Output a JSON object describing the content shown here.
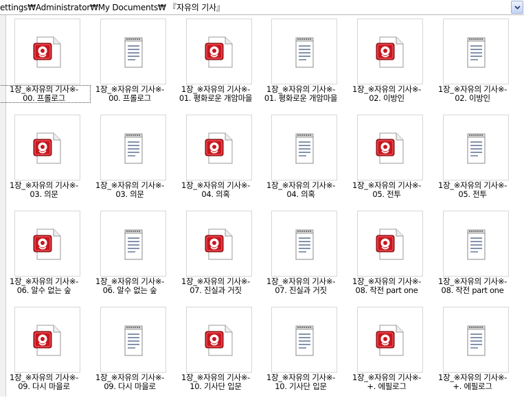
{
  "address": {
    "path": "ettings₩Administrator₩My Documents₩ 『자유의 기사』"
  },
  "colors": {
    "media_icon_red": "#c8161e",
    "doc_icon_blue": "#5a6e8f",
    "thumb_border": "#d6d6d6"
  },
  "files": [
    {
      "line1": "1장_※자유의 기사※-",
      "line2": "00. 프롤로그",
      "icon": "media-file-icon"
    },
    {
      "line1": "1장_※자유의 기사※-",
      "line2": "00. 프롤로그",
      "icon": "text-document-icon"
    },
    {
      "line1": "1장_※자유의 기사※-",
      "line2": "01. 평화로운 개암마을",
      "icon": "media-file-icon"
    },
    {
      "line1": "1장_※자유의 기사※-",
      "line2": "01. 평화로운 개암마을",
      "icon": "text-document-icon"
    },
    {
      "line1": "1장_※자유의 기사※-",
      "line2": "02. 이방인",
      "icon": "media-file-icon"
    },
    {
      "line1": "1장_※자유의 기사※-",
      "line2": "02. 이방인",
      "icon": "text-document-icon"
    },
    {
      "line1": "1장_※자유의 기사※-",
      "line2": "03. 의문",
      "icon": "media-file-icon"
    },
    {
      "line1": "1장_※자유의 기사※-",
      "line2": "03. 의문",
      "icon": "text-document-icon"
    },
    {
      "line1": "1장_※자유의 기사※-",
      "line2": "04. 의혹",
      "icon": "media-file-icon"
    },
    {
      "line1": "1장_※자유의 기사※-",
      "line2": "04. 의혹",
      "icon": "text-document-icon"
    },
    {
      "line1": "1장_※자유의 기사※-",
      "line2": "05. 전투",
      "icon": "media-file-icon"
    },
    {
      "line1": "1장_※자유의 기사※-",
      "line2": "05. 전투",
      "icon": "text-document-icon"
    },
    {
      "line1": "1장_※자유의 기사※-",
      "line2": "06. 알수 없는 숲",
      "icon": "media-file-icon"
    },
    {
      "line1": "1장_※자유의 기사※-",
      "line2": "06. 알수 없는 숲",
      "icon": "text-document-icon"
    },
    {
      "line1": "1장_※자유의 기사※-",
      "line2": "07. 진실과 거짓",
      "icon": "media-file-icon"
    },
    {
      "line1": "1장_※자유의 기사※-",
      "line2": "07. 진실과 거짓",
      "icon": "text-document-icon"
    },
    {
      "line1": "1장_※자유의 기사※-",
      "line2": "08. 작전 part one",
      "icon": "media-file-icon"
    },
    {
      "line1": "1장_※자유의 기사※-",
      "line2": "08. 작전 part one",
      "icon": "text-document-icon"
    },
    {
      "line1": "1장_※자유의 기사※-",
      "line2": "09. 다시 마을로",
      "icon": "media-file-icon"
    },
    {
      "line1": "1장_※자유의 기사※-",
      "line2": "09. 다시 마을로",
      "icon": "text-document-icon"
    },
    {
      "line1": "1장_※자유의 기사※-",
      "line2": "10. 기사단 입문",
      "icon": "media-file-icon"
    },
    {
      "line1": "1장_※자유의 기사※-",
      "line2": "10. 기사단 입문",
      "icon": "text-document-icon"
    },
    {
      "line1": "1장_※자유의 기사※-",
      "line2": "+. 에필로그",
      "icon": "media-file-icon"
    },
    {
      "line1": "1장_※자유의 기사※-",
      "line2": "+. 에필로그",
      "icon": "text-document-icon"
    }
  ]
}
